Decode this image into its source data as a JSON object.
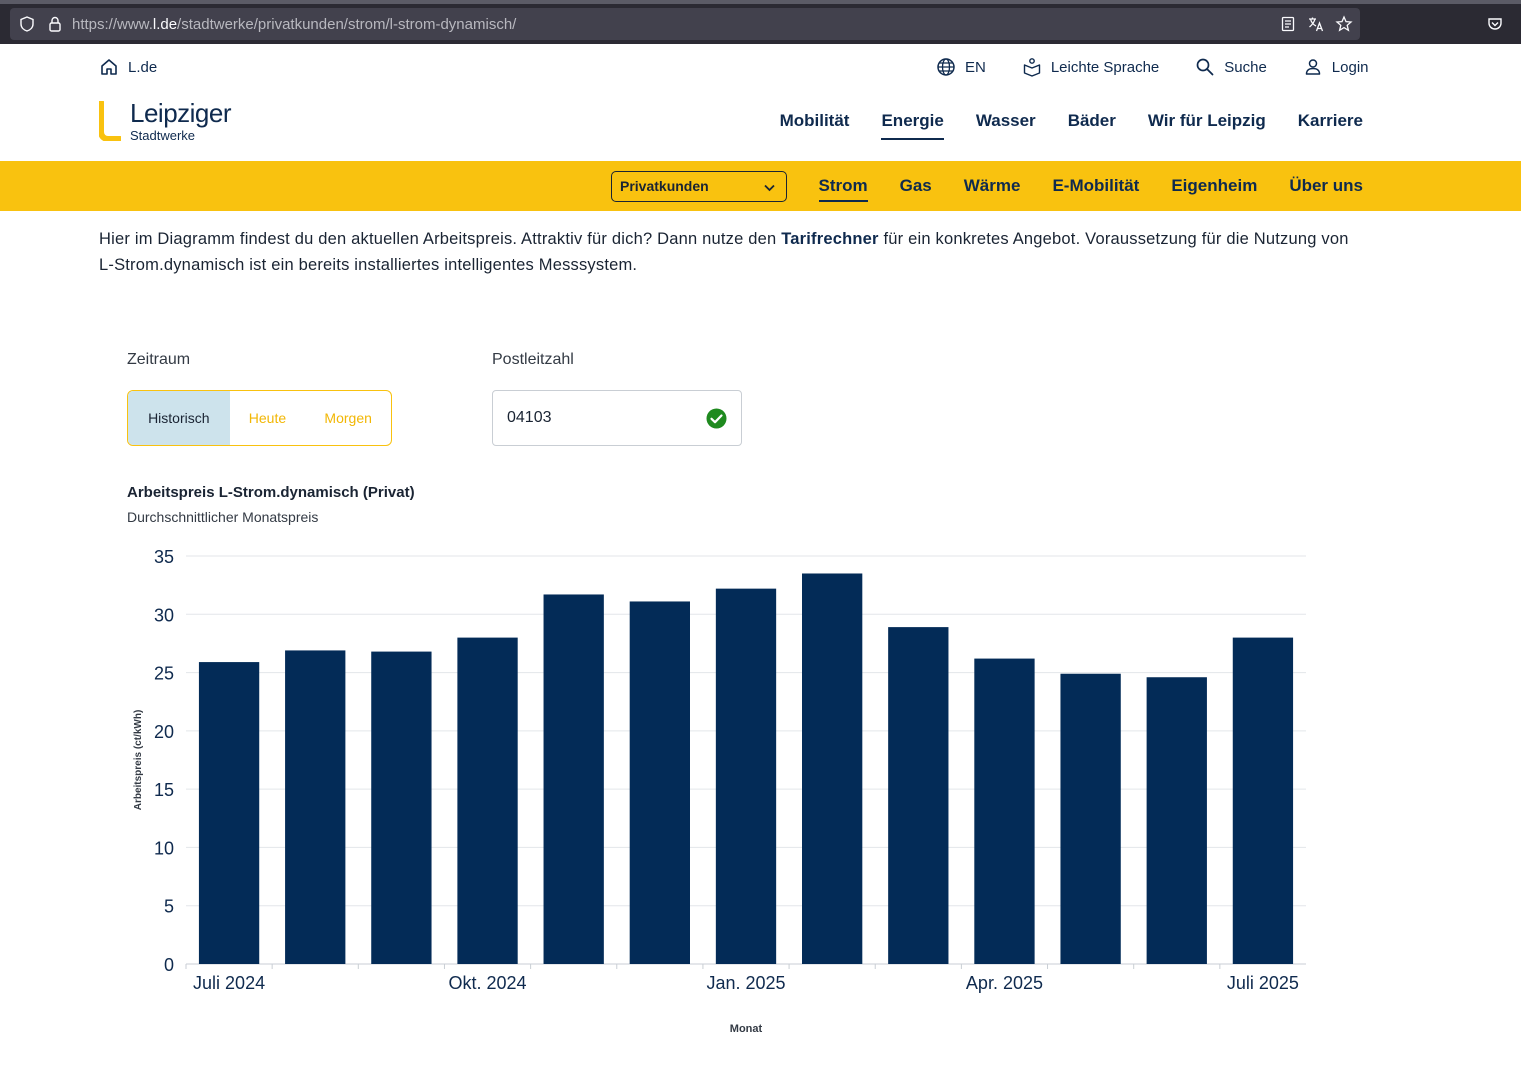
{
  "browser": {
    "url_prefix": "https://www.",
    "url_domain": "l.de",
    "url_path": "/stadtwerke/privatkunden/strom/l-strom-dynamisch/"
  },
  "utility": {
    "home_label": "L.de",
    "language_label": "EN",
    "easy_language_label": "Leichte Sprache",
    "search_label": "Suche",
    "login_label": "Login"
  },
  "logo": {
    "name": "Leipziger",
    "sub": "Stadtwerke",
    "color": "#f9c20f"
  },
  "main_nav": {
    "items": [
      "Mobilität",
      "Energie",
      "Wasser",
      "Bäder",
      "Wir für Leipzig",
      "Karriere"
    ],
    "active": "Energie"
  },
  "sub_nav": {
    "segment_select": "Privatkunden",
    "items": [
      "Strom",
      "Gas",
      "Wärme",
      "E-Mobilität",
      "Eigenheim",
      "Über uns"
    ],
    "active": "Strom",
    "bg_color": "#f9c20f"
  },
  "intro": {
    "text_before_link": "Hier im Diagramm findest du den aktuellen Arbeitspreis. Attraktiv für dich? Dann nutze den ",
    "link_text": "Tarifrechner",
    "text_after_link": " für ein konkretes Angebot. Voraussetzung für die Nutzung von L-Strom.dynamisch ist ein bereits installiertes intelligentes Messsystem."
  },
  "form": {
    "period_label": "Zeitraum",
    "period_options": [
      "Historisch",
      "Heute",
      "Morgen"
    ],
    "period_selected": "Historisch",
    "postal_label": "Postleitzahl",
    "postal_value": "04103"
  },
  "chart_data": {
    "type": "bar",
    "title": "Arbeitspreis L-Strom.dynamisch (Privat)",
    "subtitle": "Durchschnittlicher Monatspreis",
    "xlabel": "Monat",
    "ylabel": "Arbeitspreis (ct/kWh)",
    "categories": [
      "2024-07",
      "2024-08",
      "2024-09",
      "2024-10",
      "2024-11",
      "2024-12",
      "2025-01",
      "2025-02",
      "2025-03",
      "2025-04",
      "2025-05",
      "2025-06",
      "2025-07"
    ],
    "values": [
      25.9,
      26.9,
      26.8,
      28.0,
      31.7,
      31.1,
      32.2,
      33.5,
      28.9,
      26.2,
      24.9,
      24.6,
      28.0
    ],
    "x_tick_labels": [
      {
        "category": "2024-07",
        "label": "Juli 2024"
      },
      {
        "category": "2024-10",
        "label": "Okt. 2024"
      },
      {
        "category": "2025-01",
        "label": "Jan. 2025"
      },
      {
        "category": "2025-04",
        "label": "Apr. 2025"
      },
      {
        "category": "2025-07",
        "label": "Juli 2025"
      }
    ],
    "yticks": [
      0,
      5,
      10,
      15,
      20,
      25,
      30,
      35
    ],
    "ylim": [
      0,
      35
    ],
    "grid": true,
    "bar_color": "#032b57"
  }
}
